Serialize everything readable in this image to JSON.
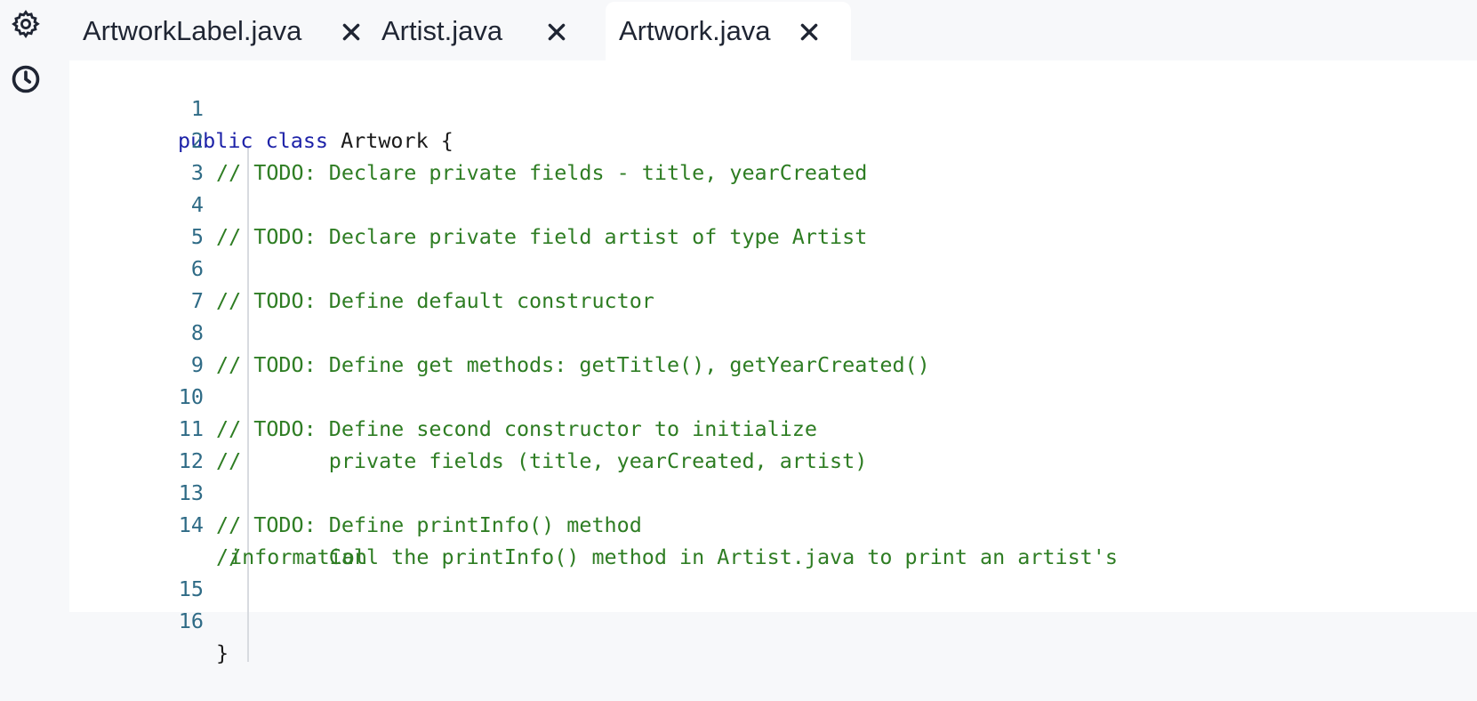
{
  "sidebar": {
    "settings_icon": "gear-icon",
    "history_icon": "clock-icon"
  },
  "tabs": [
    {
      "label": "ArtworkLabel.java",
      "active": false
    },
    {
      "label": "Artist.java",
      "active": false
    },
    {
      "label": "Artwork.java",
      "active": true
    }
  ],
  "editor": {
    "lines": [
      {
        "num": "1",
        "kw": "public class",
        "text": " Artwork {"
      },
      {
        "num": "2",
        "comment": "// TODO: Declare private fields - title, yearCreated"
      },
      {
        "num": "3",
        "comment": ""
      },
      {
        "num": "4",
        "comment": "// TODO: Declare private field artist of type Artist"
      },
      {
        "num": "5",
        "comment": ""
      },
      {
        "num": "6",
        "comment": "// TODO: Define default constructor"
      },
      {
        "num": "7",
        "comment": ""
      },
      {
        "num": "8",
        "comment": "// TODO: Define get methods: getTitle(), getYearCreated()"
      },
      {
        "num": "9",
        "comment": ""
      },
      {
        "num": "10",
        "comment": "// TODO: Define second constructor to initialize"
      },
      {
        "num": "11",
        "comment": "//       private fields (title, yearCreated, artist)"
      },
      {
        "num": "12",
        "comment": ""
      },
      {
        "num": "13",
        "comment": "// TODO: Define printInfo() method"
      },
      {
        "num": "14",
        "comment": "//       Call the printInfo() method in Artist.java to print an artist's",
        "wrap": "information"
      },
      {
        "num": "15",
        "comment": ""
      },
      {
        "num": "16",
        "text": "}"
      }
    ]
  },
  "colors": {
    "keyword": "#1d22a8",
    "comment": "#2e7d23",
    "line_number": "#2f6b86",
    "background": "#f7f8fa",
    "editor_background": "#ffffff"
  }
}
